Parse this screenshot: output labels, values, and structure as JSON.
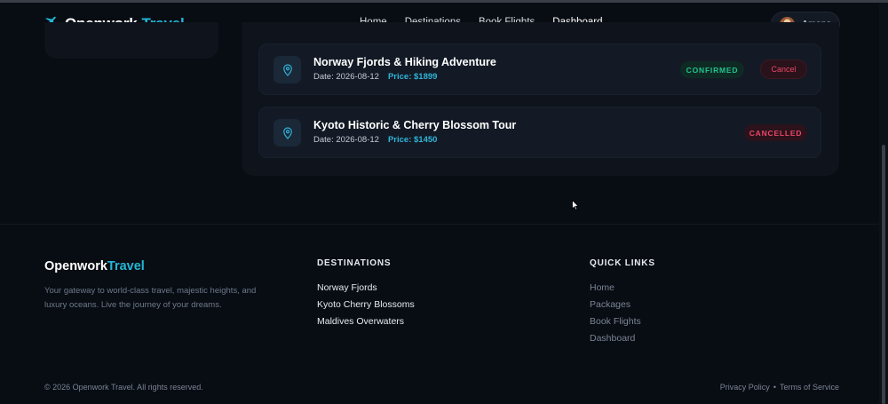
{
  "header": {
    "logo_main": "Openwork",
    "logo_accent": "Travel",
    "nav": [
      {
        "label": "Home",
        "active": false
      },
      {
        "label": "Destinations",
        "active": false
      },
      {
        "label": "Book Flights",
        "active": false
      },
      {
        "label": "Dashboard",
        "active": true
      }
    ],
    "user_name": "Amana"
  },
  "bookings": [
    {
      "title": "Norway Fjords & Hiking Adventure",
      "date": "Date: 2026-08-12",
      "price": "Price: $1899",
      "status": "CONFIRMED",
      "action": "Cancel"
    },
    {
      "title": "Kyoto Historic & Cherry Blossom Tour",
      "date": "Date: 2026-08-12",
      "price": "Price: $1450",
      "status": "CANCELLED"
    }
  ],
  "footer": {
    "logo_main": "Openwork",
    "logo_accent": "Travel",
    "tagline": "Your gateway to world-class travel, majestic heights, and luxury oceans. Live the journey of your dreams.",
    "destinations_heading": "DESTINATIONS",
    "destinations": [
      "Norway Fjords",
      "Kyoto Cherry Blossoms",
      "Maldives Overwaters"
    ],
    "quick_links_heading": "QUICK LINKS",
    "quick_links": [
      "Home",
      "Packages",
      "Book Flights",
      "Dashboard"
    ],
    "copyright": "© 2026 Openwork Travel. All rights reserved.",
    "privacy": "Privacy Policy",
    "separator": "•",
    "terms": "Terms of Service"
  },
  "icons": {
    "logo": "plane-icon",
    "booking": "map-pin-icon",
    "avatar": "user-avatar"
  },
  "colors": {
    "accent": "#22b8d6",
    "confirmed": "#22c38e",
    "cancelled": "#e9466a",
    "background": "#080c13"
  }
}
